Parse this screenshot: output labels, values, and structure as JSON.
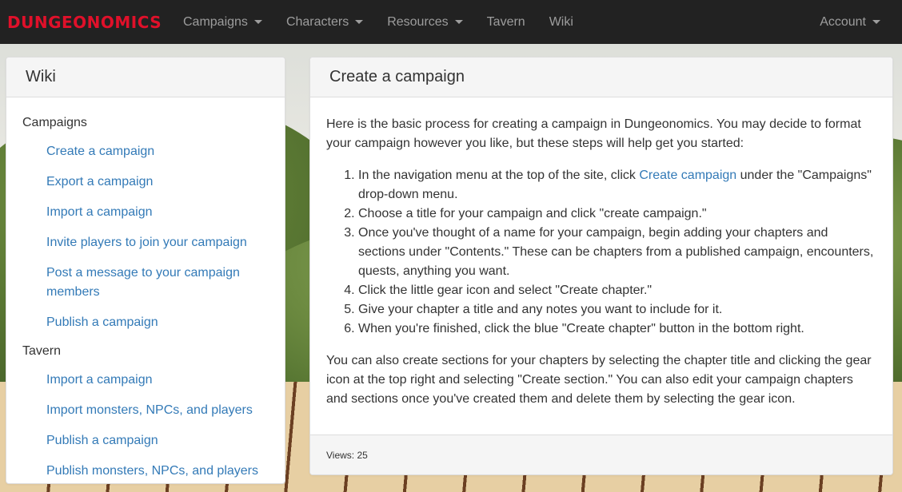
{
  "navbar": {
    "brand": "DUNGEONOMICS",
    "items": [
      {
        "label": "Campaigns",
        "dropdown": true
      },
      {
        "label": "Characters",
        "dropdown": true
      },
      {
        "label": "Resources",
        "dropdown": true
      },
      {
        "label": "Tavern",
        "dropdown": false
      },
      {
        "label": "Wiki",
        "dropdown": false
      }
    ],
    "account": "Account"
  },
  "sidebar": {
    "title": "Wiki",
    "sections": [
      {
        "label": "Campaigns",
        "links": [
          "Create a campaign",
          "Export a campaign",
          "Import a campaign",
          "Invite players to join your campaign",
          "Post a message to your campaign members",
          "Publish a campaign"
        ]
      },
      {
        "label": "Tavern",
        "links": [
          "Import a campaign",
          "Import monsters, NPCs, and players",
          "Publish a campaign",
          "Publish monsters, NPCs, and players"
        ]
      }
    ]
  },
  "article": {
    "title": "Create a campaign",
    "intro": "Here is the basic process for creating a campaign in Dungeonomics. You may decide to format your campaign however you like, but these steps will help get you started:",
    "step1_before": "In the navigation menu at the top of the site, click ",
    "step1_link": "Create campaign",
    "step1_after": " under the \"Campaigns\" drop-down menu.",
    "steps": [
      "Choose a title for your campaign and click \"create campaign.\"",
      "Once you've thought of a name for your campaign, begin adding your chapters and sections under \"Contents.\" These can be chapters from a published campaign, encounters, quests, anything you want.",
      "Click the little gear icon and select \"Create chapter.\"",
      "Give your chapter a title and any notes you want to include for it.",
      "When you're finished, click the blue \"Create chapter\" button in the bottom right."
    ],
    "outro": "You can also create sections for your chapters by selecting the chapter title and clicking the gear icon at the top right and selecting \"Create section.\" You can also edit your campaign chapters and sections once you've created them and delete them by selecting the gear icon.",
    "views": "Views: 25"
  },
  "colors": {
    "navbar_bg": "#222222",
    "brand": "#e0102a",
    "link": "#337ab7"
  }
}
